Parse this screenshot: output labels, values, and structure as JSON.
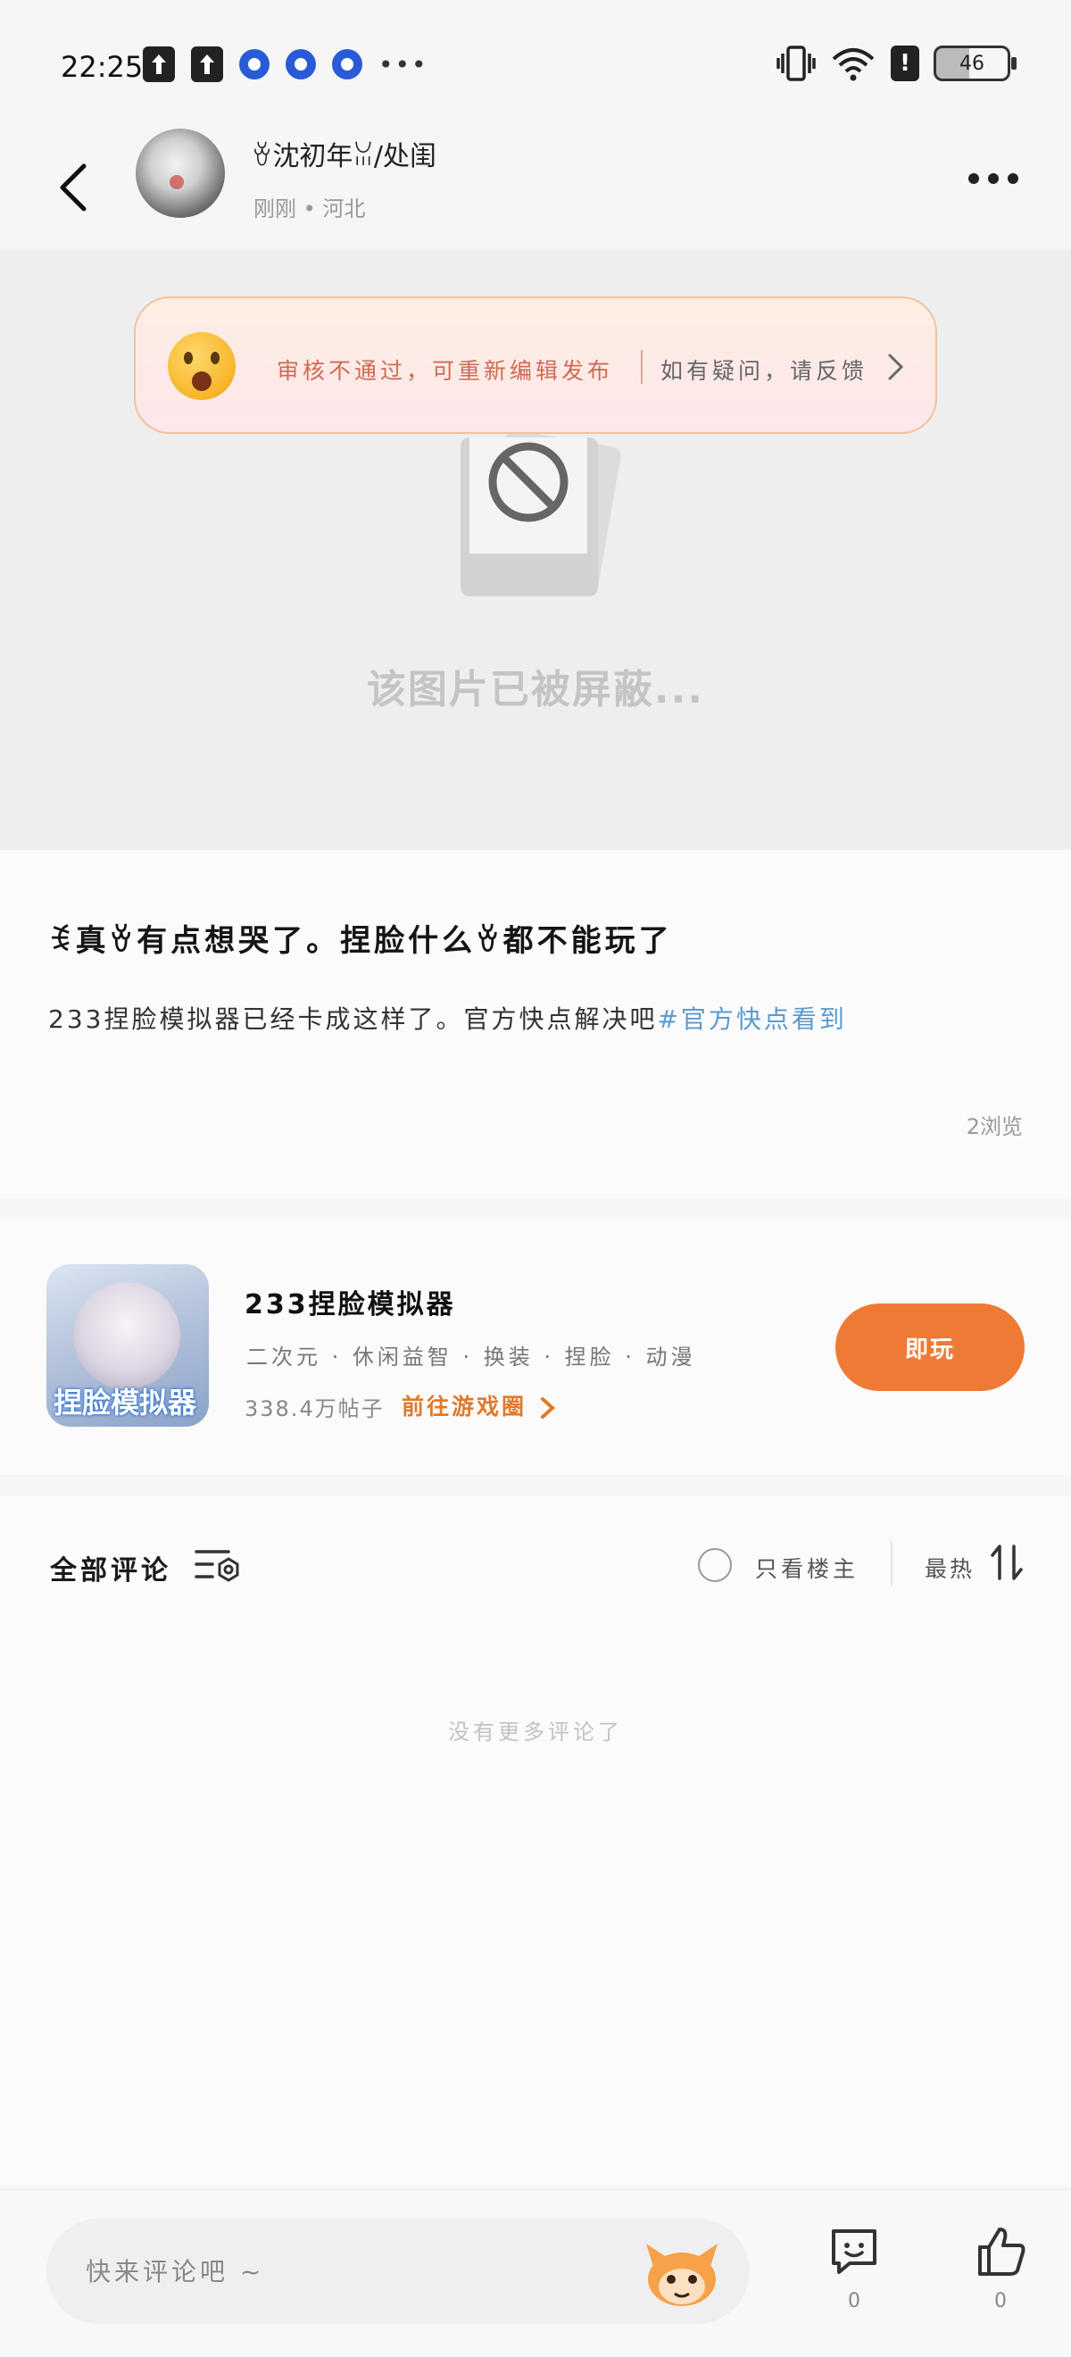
{
  "status_bar": {
    "time": "22:25",
    "dots": "•••",
    "alert": "!",
    "battery": "46",
    "icons": [
      "upload-icon",
      "upload-icon",
      "app-notification-icon",
      "app-notification-icon",
      "app-notification-icon",
      "vibrate-icon",
      "wifi-icon",
      "alert-icon",
      "battery-icon"
    ]
  },
  "header": {
    "user_name": "ꈊ沈初年ꈍ/处闺",
    "user_meta": "刚刚 • 河北",
    "back_icon": "chevron-left-icon",
    "more_icon": "more-horizontal-icon"
  },
  "review_banner": {
    "message": "审核不通过，可重新编辑发布",
    "feedback": "如有疑问，请反馈",
    "accent": "#d06a52"
  },
  "blocked_image": {
    "text": "该图片已被屏蔽..."
  },
  "post": {
    "title": "ꉂ真ꈊ有点想哭了。捏脸什么ꈊ都不能玩了",
    "text": "233捏脸模拟器已经卡成这样了。官方快点解决吧",
    "hashtag": "#官方快点看到",
    "views": "2浏览"
  },
  "game": {
    "icon_label": "捏脸模拟器",
    "name": "233捏脸模拟器",
    "tags": "二次元 · 休闲益智 · 换装 · 捏脸 · 动漫",
    "posts": "338.4万帖子",
    "link": "前往游戏圈",
    "play_button": "即玩",
    "accent": "#ef7a36"
  },
  "comments": {
    "title": "全部评论",
    "only_host": "只看楼主",
    "sort": "最热",
    "empty": "没有更多评论了"
  },
  "bottom_bar": {
    "placeholder": "快来评论吧 ~",
    "comment_count": "0",
    "like_count": "0"
  }
}
